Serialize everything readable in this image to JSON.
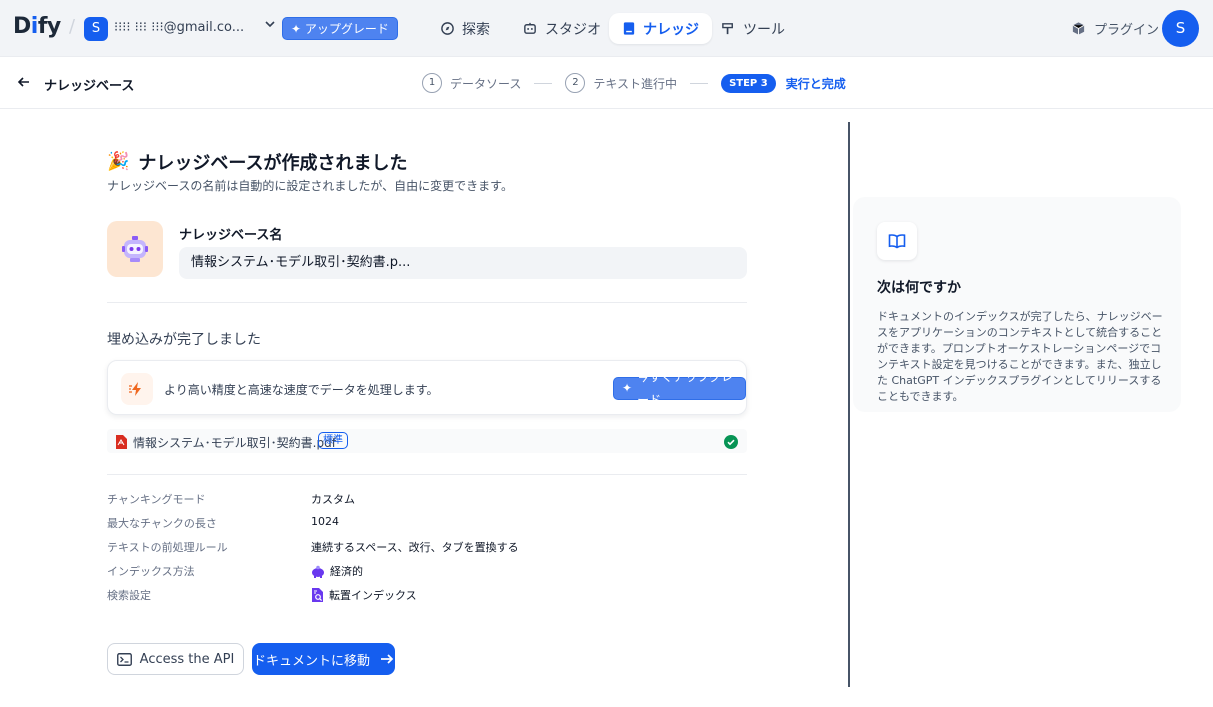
{
  "app": {
    "logo": "Dify"
  },
  "workspace": {
    "avatar": "S",
    "email": "⁝⁝⁝⁝ ⁝⁝⁝ ⁝⁝⁝@gmail.co...",
    "upgrade": "アップグレード"
  },
  "nav": {
    "explore": "探索",
    "studio": "スタジオ",
    "knowledge": "ナレッジ",
    "tools": "ツール"
  },
  "plugin": "プラグイン",
  "user_avatar": "S",
  "header": {
    "title": "ナレッジベース"
  },
  "steps": [
    {
      "num": "1",
      "label": "データソース"
    },
    {
      "num": "2",
      "label": "テキスト進行中"
    },
    {
      "badge": "STEP 3",
      "label": "実行と完成"
    }
  ],
  "main": {
    "created_title": "ナレッジベースが作成されました",
    "created_sub": "ナレッジベースの名前は自動的に設定されましたが、自由に変更できます。",
    "name_label": "ナレッジベース名",
    "name_value": "情報システム･モデル取引･契約書.p...",
    "embed_title": "埋め込みが完了しました",
    "upgrade_text": "より高い精度と高速な速度でデータを処理します。",
    "upgrade_button": "今すぐアップグレード",
    "file_name": "情報システム･モデル取引･契約書.pdf",
    "file_badge": "標準",
    "info": [
      {
        "key": "チャンキングモード",
        "value": "カスタム"
      },
      {
        "key": "最大なチャンクの長さ",
        "value": "1024"
      },
      {
        "key": "テキストの前処理ルール",
        "value": "連続するスペース、改行、タブを置換する"
      },
      {
        "key": "インデックス方法",
        "value": "経済的"
      },
      {
        "key": "検索設定",
        "value": "転置インデックス"
      }
    ],
    "api_button": "Access the API",
    "doc_button": "ドキュメントに移動"
  },
  "side": {
    "title": "次は何ですか",
    "text": "ドキュメントのインデックスが完了したら、ナレッジベースをアプリケーションのコンテキストとして統合することができます。プロンプトオーケストレーションページでコンテキスト設定を見つけることができます。また、独立した ChatGPT インデックスプラグインとしてリリースすることもできます。"
  },
  "colors": {
    "primary": "#155eef",
    "success": "#079455",
    "pdf": "#d92d20"
  }
}
